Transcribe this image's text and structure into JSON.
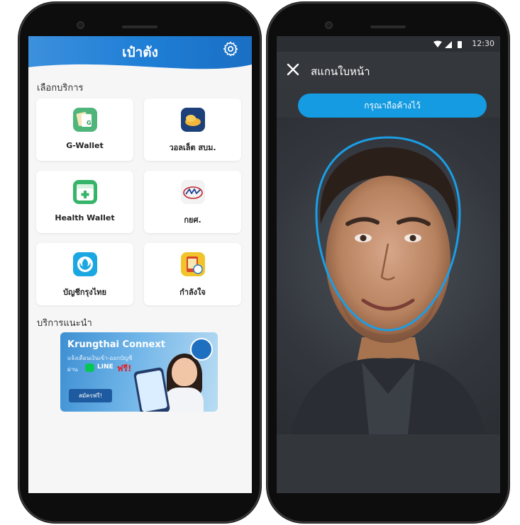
{
  "left_phone": {
    "header": {
      "title": "เป๋าตัง",
      "accent": "#1f7fd6"
    },
    "services_title": "เลือกบริการ",
    "services": [
      {
        "label": "G-Wallet",
        "icon": "g-wallet-icon"
      },
      {
        "label": "วอลเล็ต สบม.",
        "icon": "bond-wallet-icon"
      },
      {
        "label": "Health Wallet",
        "icon": "health-wallet-icon"
      },
      {
        "label": "กยศ.",
        "icon": "student-loan-icon"
      },
      {
        "label": "บัญชีกรุงไทย",
        "icon": "krungthai-bank-icon"
      },
      {
        "label": "กำลังใจ",
        "icon": "kamlangjai-icon"
      }
    ],
    "recommended_title": "บริการแนะนำ",
    "banner": {
      "title": "Krungthai Connext",
      "line1": "แจ้งเตือนเงินเข้า-ออกบัญชี",
      "line2_prefix": "ผ่าน",
      "line_label": "LINE",
      "free_label": "ฟรี!",
      "button": "สมัครฟรี!"
    }
  },
  "right_phone": {
    "status": {
      "time": "12:30"
    },
    "toolbar": {
      "title": "สแกนใบหน้า"
    },
    "instruction": "กรุณาถือค้างไว้",
    "oval_color": "#1a9ee6"
  }
}
